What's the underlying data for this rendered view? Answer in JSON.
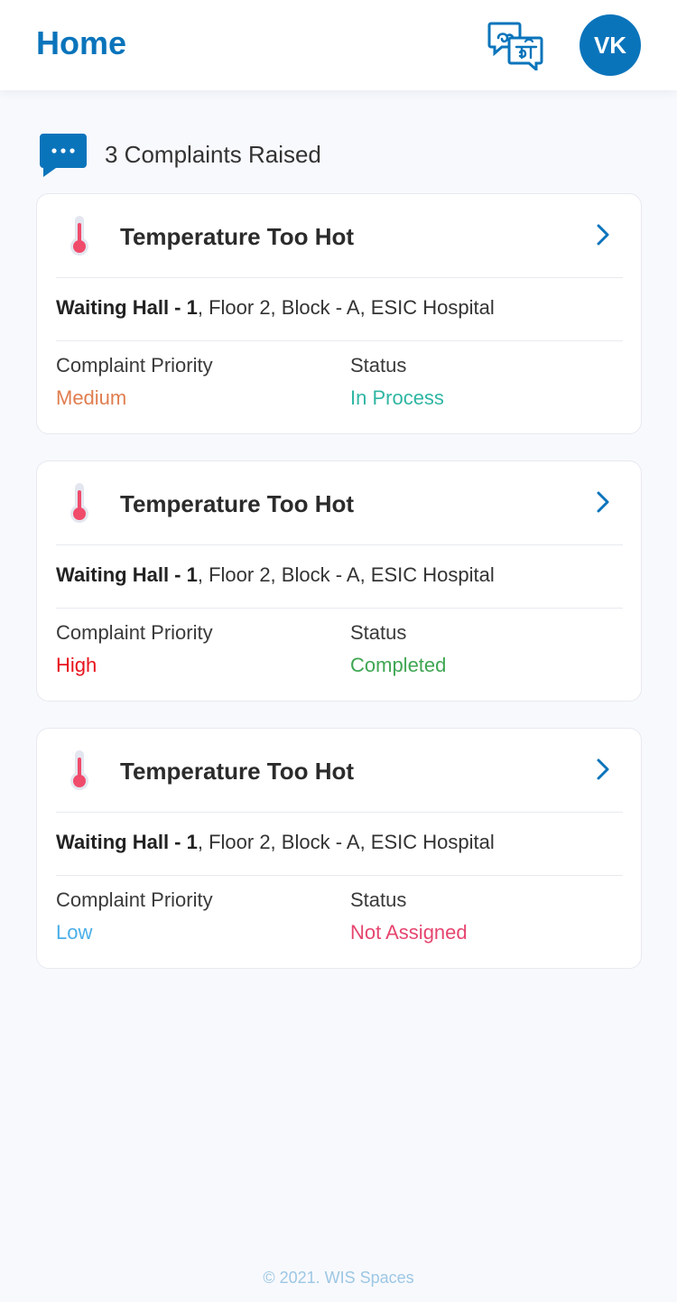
{
  "header": {
    "title": "Home",
    "language_icon": "language-switch-icon",
    "avatar_initials": "VK"
  },
  "summary": {
    "icon": "chat-bubble-icon",
    "text": "3 Complaints Raised"
  },
  "complaints": [
    {
      "title": "Temperature Too Hot",
      "icon": "thermometer-icon",
      "location_bold": "Waiting Hall - 1",
      "location_rest": ", Floor 2, Block - A, ESIC Hospital",
      "priority_label": "Complaint Priority",
      "priority": "Medium",
      "priority_color": "#e07d4f",
      "status_label": "Status",
      "status": "In Process",
      "status_color": "#2fb6a3"
    },
    {
      "title": "Temperature Too Hot",
      "icon": "thermometer-icon",
      "location_bold": "Waiting Hall - 1",
      "location_rest": ", Floor 2, Block - A, ESIC Hospital",
      "priority_label": "Complaint Priority",
      "priority": "High",
      "priority_color": "#e8131c",
      "status_label": "Status",
      "status": "Completed",
      "status_color": "#3fa652"
    },
    {
      "title": "Temperature Too Hot",
      "icon": "thermometer-icon",
      "location_bold": "Waiting Hall - 1",
      "location_rest": ", Floor 2, Block - A, ESIC Hospital",
      "priority_label": "Complaint Priority",
      "priority": "Low",
      "priority_color": "#4aaee8",
      "status_label": "Status",
      "status": "Not Assigned",
      "status_color": "#e6456f"
    }
  ],
  "colors": {
    "brand": "#0a74bb",
    "background": "#f8f9fd"
  },
  "footer": {
    "text": "© 2021. WIS Spaces"
  }
}
